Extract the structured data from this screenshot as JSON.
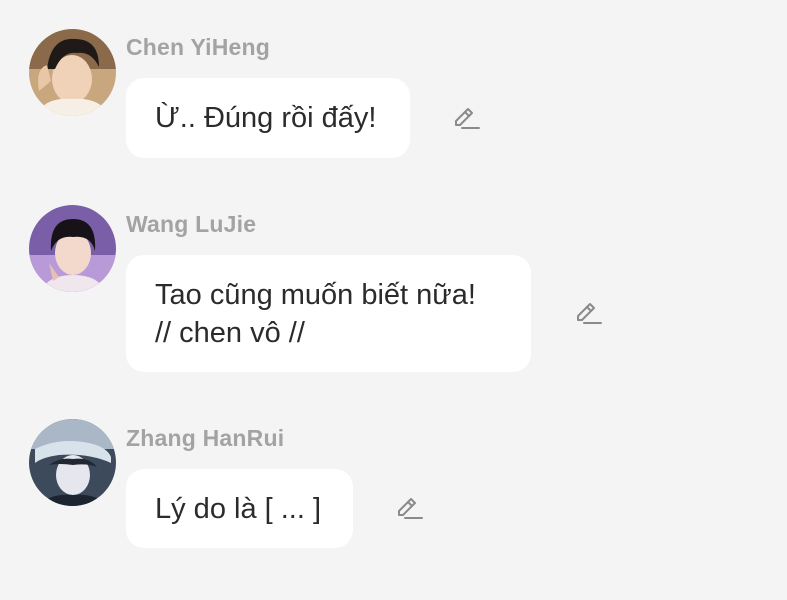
{
  "messages": [
    {
      "sender": "Chen YiHeng",
      "lines": [
        "Ừ.. Đúng rồi đấy!"
      ],
      "avatar_icon": "avatar-photo-icon",
      "edit_icon": "pencil-icon"
    },
    {
      "sender": "Wang LuJie",
      "lines": [
        "Tao cũng muốn biết nữa!",
        "// chen vô //"
      ],
      "avatar_icon": "avatar-photo-icon",
      "edit_icon": "pencil-icon"
    },
    {
      "sender": "Zhang HanRui",
      "lines": [
        "Lý do là [ ... ]"
      ],
      "avatar_icon": "avatar-photo-icon",
      "edit_icon": "pencil-icon"
    }
  ],
  "colors": {
    "background": "#f4f4f4",
    "bubble": "#ffffff",
    "sender_text": "#a3a3a3",
    "message_text": "#2b2b2b",
    "edit_icon": "#8a8a8a"
  }
}
